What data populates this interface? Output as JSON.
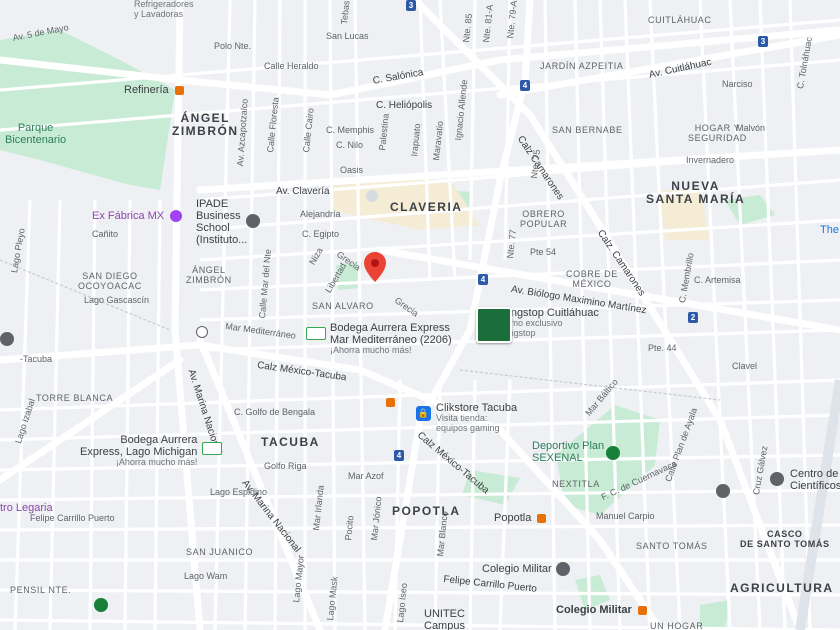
{
  "map": {
    "background": "#eef0f3",
    "road_color": "#ffffff",
    "park_color": "#c8ebd5",
    "highway_color": "#dfe3ea"
  },
  "neighborhoods": {
    "angel_zimbron": [
      "ÁNGEL",
      "ZIMBRÓN"
    ],
    "claveria": "CLAVERIA",
    "nueva_santa_maria": [
      "NUEVA",
      "SANTA MARÍA"
    ],
    "tacuba": "TACUBA",
    "popotla": "POPOTLA",
    "agricultura": "AGRICULTURA",
    "casco": [
      "CASCO",
      "DE SANTO TOMÁS"
    ]
  },
  "small_areas": {
    "cuitlahuac": "CUITLÁHUAC",
    "jardin_azpeitia": "JARDÍN AZPEITIA",
    "san_bernabe": "SAN BERNABE",
    "hogar": [
      "HOGAR Y",
      "SEGURIDAD"
    ],
    "obrero": [
      "OBRERO",
      "POPULAR"
    ],
    "cobre": [
      "COBRE DE",
      "MÉXICO"
    ],
    "san_diego": [
      "SAN DIEGO",
      "OCOYOACAC"
    ],
    "angel_zimbron_small": [
      "ÁNGEL",
      "ZIMBRÓN"
    ],
    "san_alvaro": "SAN ALVARO",
    "torre_blanca": "TORRE BLANCA",
    "nextitla": "NEXTITLA",
    "santo_tomas": "SANTO TOMÁS",
    "san_juanico": "SAN JUANICO",
    "pensil": "PENSIL NTE.",
    "un_hogar": "UN HOGAR"
  },
  "streets": {
    "av5mayo": "Av. 5 de Mayo",
    "polo_nte": "Polo Nte.",
    "calle_heraldo": "Calle Heraldo",
    "san_lucas": "San Lucas",
    "salonica": "C. Salónica",
    "heliopolis": "C. Heliópolis",
    "memphis": "C. Memphis",
    "nilo": "C. Nilo",
    "oasis": "Oasis",
    "av_claveria": "Av. Clavería",
    "alejandria": "Alejandría",
    "egipto": "C. Egipto",
    "grecia1": "Grecia",
    "grecia2": "Grecia",
    "niza": "Niza",
    "libertad": "Libertad",
    "biologo": "Av. Biólogo Maximino Martínez",
    "mar_mediterraneo": "Mar Mediterráneo",
    "calz_mexico_tacuba": "Calz México-Tacuba",
    "calz_mexico_tacuba2": "Calz México-Tacuba",
    "golfo_bengala": "C. Golfo de Bengala",
    "golfo_riga": "Golfo Riga",
    "mar_azof": "Mar Azof",
    "av_marina": "Av. Marina Nacional",
    "av_marina2": "Av. Marina Nacional",
    "av_cuitlahuac": "Av. Cuitláhuac",
    "narciso": "Narciso",
    "malvon": "Malvón",
    "invernadero": "Invernadero",
    "calz_camarones": "Calz Camarones",
    "calz_camarones2": "Calz. Camarones",
    "pte54": "Pte 54",
    "pte44": "Pte. 44",
    "artemisa": "C. Artemisa",
    "clavel": "Clavel",
    "felipe_carrillo": "Felipe Carrillo Puerto",
    "felipe_carrillo2": "Felipe Carrillo Puerto",
    "lago_espidino": "Lago Espidino",
    "manuel_carpio": "Manuel Carpio",
    "fc_cuernavaca": "F. C. de Cuernavaca",
    "lago_gascascin": "Lago Gascascín",
    "canito": "Cañito",
    "mar_baltico": "Mar Báltico",
    "ignacio_allende": "Ignacio Allende",
    "maravatio": "Maravatio",
    "irapuato": "Irapuato",
    "palestina": "Palestina",
    "calle_cairo": "Calle Cairo",
    "calle_floresta": "Calle Floresta",
    "av_azcapotzalco": "Av. Azcapotzalco",
    "lago_pleyo": "Lago Pleyo",
    "calle_mar_norte": "Calle Mar del Nte",
    "lago_isabal": "Lago Izabal",
    "tebas": "Tebas",
    "nte85": "Nte. 85",
    "nte81": "Nte. 81-A",
    "nte79": "Nte. 79-A",
    "nte75": "Nte. 75",
    "nte77": "Nte. 77",
    "tolnahuac": "C. Tolnáhuac",
    "pte_tacuba": "-Tacuba",
    "lago_mask": "Lago Mask",
    "mar_jonico": "Mar Jónico",
    "mar_blanco": "Mar Blanco",
    "lago_iseo": "Lago Iseo",
    "lago_wam": "Lago Wam",
    "lago_mayor": "Lago Mayor",
    "pocito": "Pocito",
    "mar_irlanda": "Mar Irlanda",
    "calle_plan_ayala": "Calle Plan de Ayala",
    "cruz_galvez": "Cruz Gálvez",
    "c_membrillo": "C. Membrillo"
  },
  "pois": {
    "refineria": "Refinería",
    "parque_bicentenario": [
      "Parque",
      "Bicentenario"
    ],
    "ex_fabrica": "Ex Fábrica MX",
    "ipade": [
      "IPADE",
      "Business",
      "School",
      "(Instituto..."
    ],
    "bodega_mar": {
      "name": [
        "Bodega Aurrera Express",
        "Mar Mediterráneo (2206)"
      ],
      "sub": "¡Ahorra mucho más!"
    },
    "bodega_michigan": {
      "name": [
        "Bodega Aurrera",
        "Express, Lago Michigan"
      ],
      "sub": "¡Ahorra mucho más!"
    },
    "wingstop": {
      "name": "Wingstop Cuitláhuac",
      "sub": [
        "Termo exclusivo",
        "Wingstop"
      ]
    },
    "clikstore": {
      "name": "Clikstore Tacuba",
      "sub": [
        "Visita tienda:",
        "equipos gaming"
      ]
    },
    "deportivo": [
      "Deportivo Plan",
      "SEXENAL"
    ],
    "popotla_metro": "Popotla",
    "colegio_militar": "Colegio Militar",
    "colegio_militar_metro": "Colegio Militar",
    "unitec": [
      "UNITEC",
      "Campus"
    ],
    "centro": [
      "Centro de",
      "Científicos"
    ],
    "tro_legaria": "tro Legaria",
    "lavadoras": [
      "Refrigeradores",
      "y Lavadoras"
    ],
    "the": "The"
  },
  "shields": {
    "s3a": "3",
    "s3b": "3",
    "s4a": "4",
    "s4b": "4",
    "s4c": "4",
    "s2": "2"
  }
}
